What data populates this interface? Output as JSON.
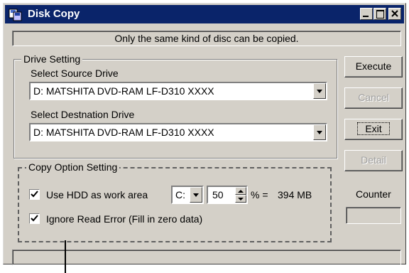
{
  "window": {
    "title": "Disk Copy",
    "message": "Only the same kind of disc can be copied."
  },
  "drive_setting": {
    "group_label": "Drive Setting",
    "source_label": "Select Source Drive",
    "source_value": "D: MATSHITA DVD-RAM LF-D310 XXXX",
    "destination_label": "Select Destnation Drive",
    "destination_value": "D: MATSHITA DVD-RAM LF-D310 XXXX"
  },
  "buttons": {
    "execute": "Execute",
    "cancel": "Cancel",
    "exit": "Exit",
    "detail": "Detail"
  },
  "copy_option": {
    "group_label": "Copy Option Setting",
    "use_hdd_label": "Use HDD as work area",
    "use_hdd_checked": true,
    "drive_value": "C:",
    "percent_value": "50",
    "percent_suffix": "% =",
    "size_value": "394 MB",
    "ignore_error_label": "Ignore Read Error (Fill in zero data)",
    "ignore_error_checked": true
  },
  "counter": {
    "label": "Counter",
    "value": ""
  },
  "icons": [
    "disk-copy-app-icon",
    "minimize-icon",
    "maximize-icon",
    "close-icon",
    "dropdown-arrow-icon",
    "spin-up-icon",
    "spin-down-icon",
    "checkmark-icon"
  ]
}
